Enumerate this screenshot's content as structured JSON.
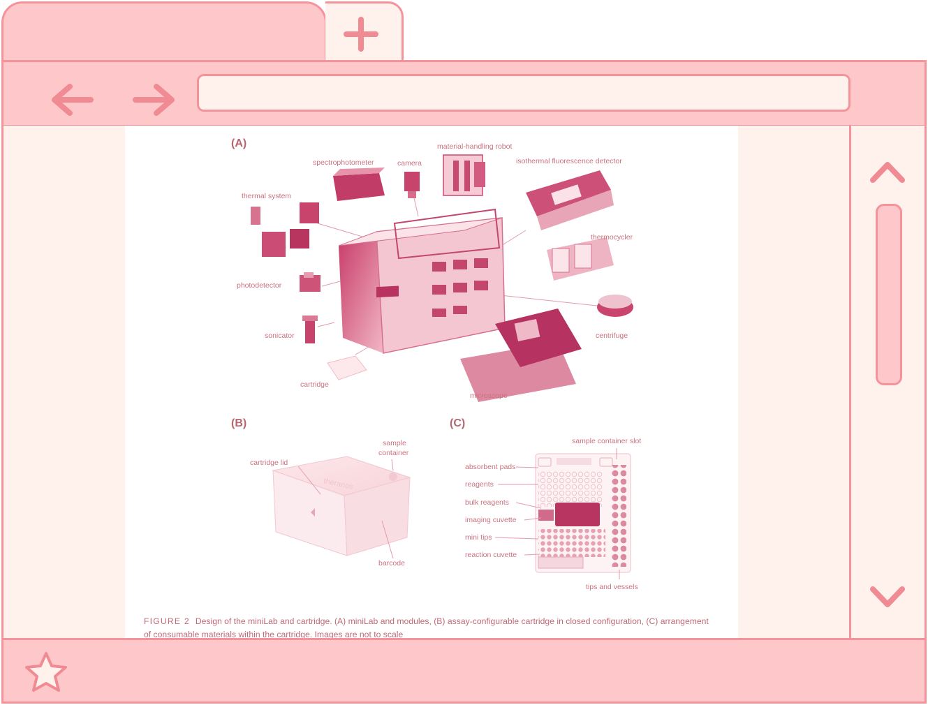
{
  "browser": {
    "address_value": "",
    "icons": {
      "new_tab": "plus-icon",
      "back": "arrow-left-icon",
      "forward": "arrow-right-icon",
      "scroll_up": "chevron-up-icon",
      "scroll_down": "chevron-down-icon",
      "bookmark": "star-icon"
    },
    "colors": {
      "chrome": "#fec8cb",
      "border": "#f5939b",
      "page": "#fff2ec",
      "accent": "#c8436a"
    }
  },
  "figure": {
    "panel_a": "(A)",
    "panel_b": "(B)",
    "panel_c": "(C)",
    "a_labels": {
      "material_handling_robot": "material-handling robot",
      "spectrophotometer": "spectrophotometer",
      "camera": "camera",
      "isothermal": "isothermal fluorescence detector",
      "thermal_system": "thermal system",
      "thermocycler": "thermocycler",
      "photodetector": "photodetector",
      "sonicator": "sonicator",
      "centrifuge": "centrifuge",
      "cartridge": "cartridge",
      "microscope": "microscope"
    },
    "b_labels": {
      "sample_container_line1": "sample",
      "sample_container_line2": "container",
      "cartridge_lid": "cartridge lid",
      "barcode": "barcode",
      "brand_mark": "theranos"
    },
    "c_labels": {
      "sample_container_slot": "sample container slot",
      "absorbent_pads": "absorbent pads",
      "reagents": "reagents",
      "bulk_reagents": "bulk reagents",
      "imaging_cuvette": "imaging cuvette",
      "mini_tips": "mini tips",
      "reaction_cuvette": "reaction cuvette",
      "tips_and_vessels": "tips and vessels"
    },
    "caption_label": "FIGURE 2",
    "caption_text": "Design of the miniLab and cartridge. (A) miniLab and modules, (B) assay-configurable cartridge in closed configuration, (C) arrangement of consumable materials within the cartridge. Images are not to scale"
  }
}
